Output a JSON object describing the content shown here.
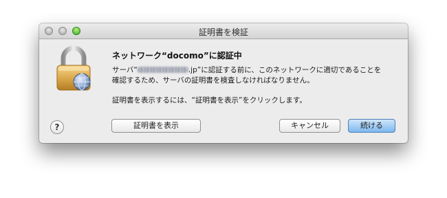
{
  "window": {
    "title": "証明書を検証"
  },
  "dialog": {
    "heading": "ネットワーク“docomo”に認証中",
    "message_prefix": "サーバ“",
    "message_suffix": ".jp”に認証する前に、このネットワークに適切であることを",
    "message_line2": "確認するため、サーバの証明書を検査しなければなりません。",
    "instruction": "証明書を表示するには、“証明書を表示”をクリックします。"
  },
  "buttons": {
    "show_certificate": "証明書を表示",
    "cancel": "キャンセル",
    "continue": "続ける",
    "help": "?"
  },
  "icons": {
    "lock": "lock-icon",
    "globe": "network-globe-icon"
  },
  "colors": {
    "default_button": "#7cb7ef",
    "zoom_button": "#3ca82a"
  }
}
